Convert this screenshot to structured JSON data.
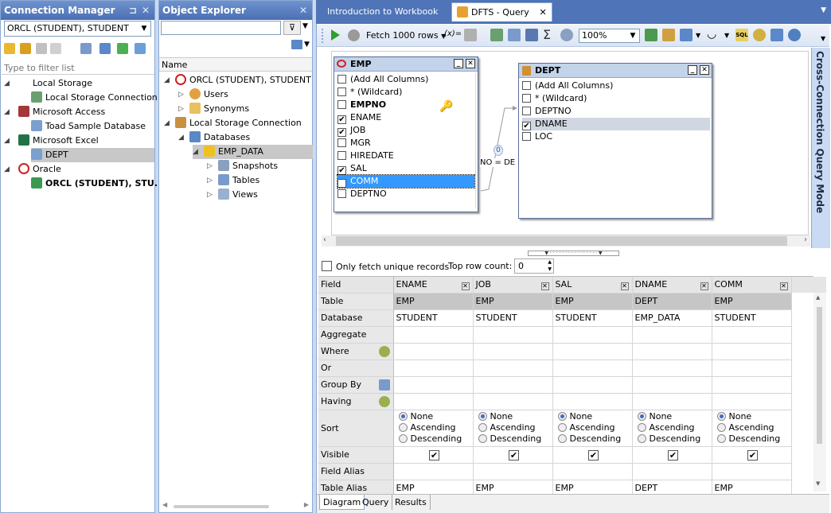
{
  "connection_manager": {
    "title": "Connection Manager",
    "selected_connection": "ORCL (STUDENT), STUDENT",
    "filter_placeholder": "Type to filter list",
    "tree": [
      {
        "label": "Local Storage",
        "level": 0
      },
      {
        "label": "Local Storage Connection",
        "level": 1
      },
      {
        "label": "Microsoft Access",
        "level": 0
      },
      {
        "label": "Toad Sample Database",
        "level": 1
      },
      {
        "label": "Microsoft Excel",
        "level": 0
      },
      {
        "label": "DEPT",
        "level": 1
      },
      {
        "label": "Oracle",
        "level": 0
      },
      {
        "label": "ORCL (STUDENT), STU...",
        "level": 1
      }
    ]
  },
  "object_explorer": {
    "title": "Object Explorer",
    "column_header": "Name",
    "tree": [
      {
        "label": "ORCL (STUDENT), STUDENT"
      },
      {
        "label": "Users"
      },
      {
        "label": "Synonyms"
      },
      {
        "label": "Local Storage Connection"
      },
      {
        "label": "Databases"
      },
      {
        "label": "EMP_DATA"
      },
      {
        "label": "Snapshots"
      },
      {
        "label": "Tables"
      },
      {
        "label": "Views"
      }
    ]
  },
  "tabs": [
    {
      "label": "Introduction to Workbook"
    },
    {
      "label": "DFTS - Query"
    }
  ],
  "toolbar": {
    "fetch_label": "Fetch 1000 rows",
    "zoom": "100%"
  },
  "side_label": "Cross-Connection Query Mode",
  "diagram": {
    "emp": {
      "name": "EMP",
      "columns": [
        {
          "label": "(Add All Columns)",
          "checked": false
        },
        {
          "label": "* (Wildcard)",
          "checked": false
        },
        {
          "label": "EMPNO",
          "checked": false
        },
        {
          "label": "ENAME",
          "checked": true
        },
        {
          "label": "JOB",
          "checked": true
        },
        {
          "label": "MGR",
          "checked": false
        },
        {
          "label": "HIREDATE",
          "checked": false
        },
        {
          "label": "SAL",
          "checked": true
        },
        {
          "label": "COMM",
          "checked": true
        },
        {
          "label": "DEPTNO",
          "checked": false
        }
      ]
    },
    "dept": {
      "name": "DEPT",
      "columns": [
        {
          "label": "(Add All Columns)",
          "checked": false
        },
        {
          "label": "* (Wildcard)",
          "checked": false
        },
        {
          "label": "DEPTNO",
          "checked": false
        },
        {
          "label": "DNAME",
          "checked": true
        },
        {
          "label": "LOC",
          "checked": false
        }
      ]
    },
    "join_count": "0",
    "join_label": "NO = DEF"
  },
  "options": {
    "unique_label": "Only fetch unique records",
    "top_row_label": "Top row count:",
    "top_row_value": "0"
  },
  "grid": {
    "row_labels": [
      "Field",
      "Table",
      "Database",
      "Aggregate",
      "Where",
      "Or",
      "Group By",
      "Having",
      "Sort",
      "Visible",
      "Field Alias",
      "Table Alias"
    ],
    "sort_options": [
      "None",
      "Ascending",
      "Descending"
    ],
    "columns": [
      {
        "field": "ENAME",
        "table": "EMP",
        "database": "STUDENT",
        "table_alias": "EMP"
      },
      {
        "field": "JOB",
        "table": "EMP",
        "database": "STUDENT",
        "table_alias": "EMP"
      },
      {
        "field": "SAL",
        "table": "EMP",
        "database": "STUDENT",
        "table_alias": "EMP"
      },
      {
        "field": "DNAME",
        "table": "DEPT",
        "database": "EMP_DATA",
        "table_alias": "DEPT"
      },
      {
        "field": "COMM",
        "table": "EMP",
        "database": "STUDENT",
        "table_alias": "EMP"
      }
    ]
  },
  "bottom_tabs": [
    "Diagram",
    "Query",
    "Results"
  ]
}
